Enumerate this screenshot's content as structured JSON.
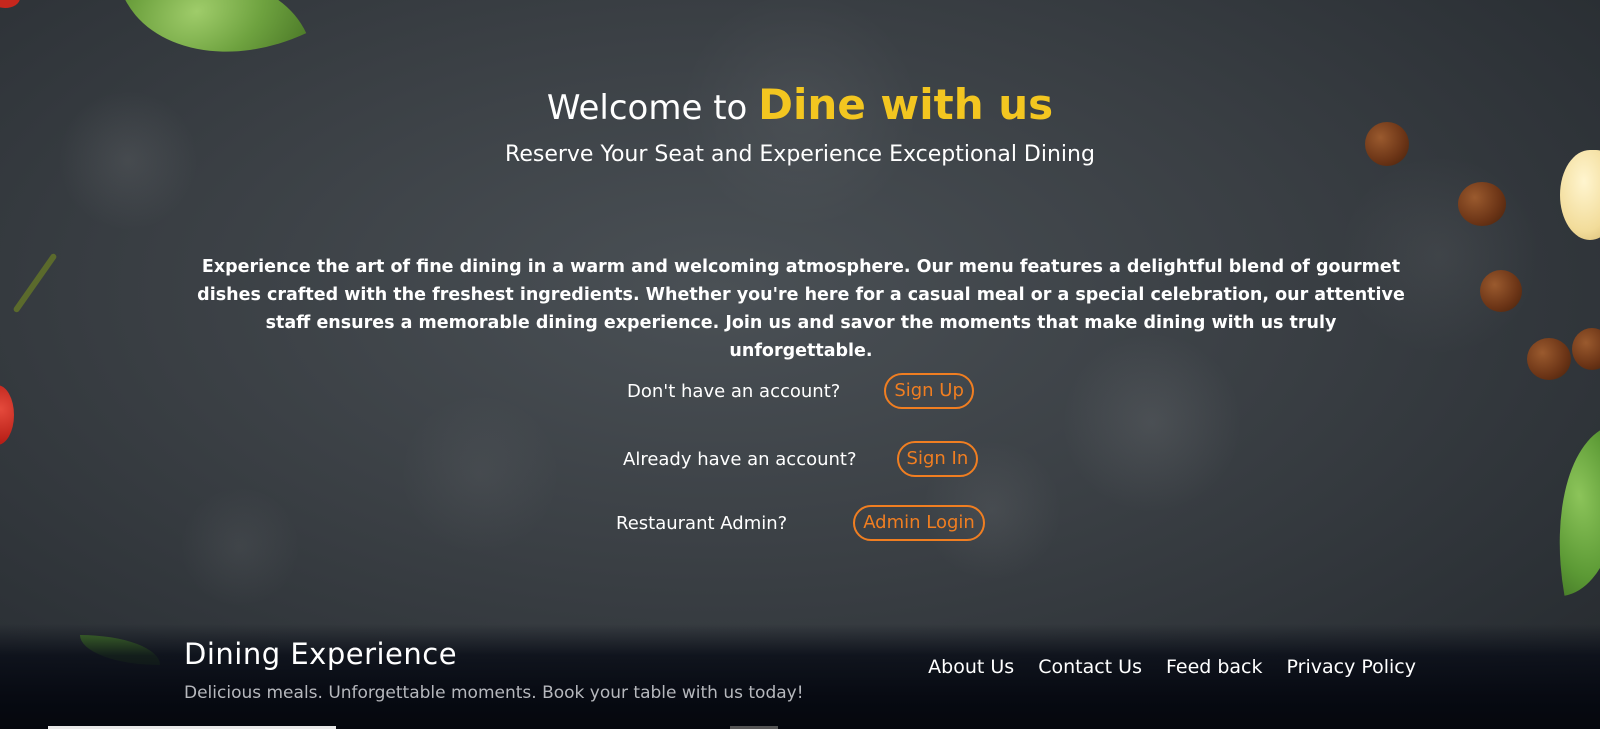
{
  "hero": {
    "welcome_prefix": "Welcome to",
    "brand": "Dine with us",
    "tagline": "Reserve Your Seat and Experience Exceptional Dining",
    "description": "Experience the art of fine dining in a warm and welcoming atmosphere. Our menu features a delightful blend of gourmet dishes crafted with the freshest ingredients. Whether you're here for a casual meal or a special celebration, our attentive staff ensures a memorable dining experience. Join us and savor the moments that make dining with us truly unforgettable."
  },
  "auth": {
    "signup_prompt": "Don't have an account?",
    "signup_label": "Sign Up",
    "signin_prompt": "Already have an account?",
    "signin_label": "Sign In",
    "admin_prompt": "Restaurant Admin?",
    "admin_label": "Admin Login"
  },
  "footer": {
    "brand": "Dining Experience",
    "subtitle": "Delicious meals. Unforgettable moments. Book your table with us today!",
    "links": [
      "About Us",
      "Contact Us",
      "Feed back",
      "Privacy Policy"
    ]
  },
  "colors": {
    "accent_yellow": "#f3c620",
    "accent_orange": "#f07e21",
    "background": "#3a3f44",
    "footer_bg": "#05070d"
  }
}
